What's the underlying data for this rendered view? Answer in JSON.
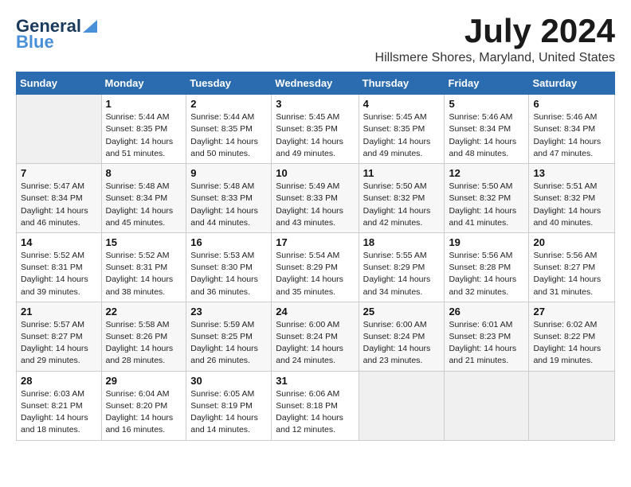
{
  "header": {
    "logo_line1": "General",
    "logo_line2": "Blue",
    "month_title": "July 2024",
    "location": "Hillsmere Shores, Maryland, United States"
  },
  "weekdays": [
    "Sunday",
    "Monday",
    "Tuesday",
    "Wednesday",
    "Thursday",
    "Friday",
    "Saturday"
  ],
  "weeks": [
    [
      {
        "day": "",
        "info": ""
      },
      {
        "day": "1",
        "info": "Sunrise: 5:44 AM\nSunset: 8:35 PM\nDaylight: 14 hours\nand 51 minutes."
      },
      {
        "day": "2",
        "info": "Sunrise: 5:44 AM\nSunset: 8:35 PM\nDaylight: 14 hours\nand 50 minutes."
      },
      {
        "day": "3",
        "info": "Sunrise: 5:45 AM\nSunset: 8:35 PM\nDaylight: 14 hours\nand 49 minutes."
      },
      {
        "day": "4",
        "info": "Sunrise: 5:45 AM\nSunset: 8:35 PM\nDaylight: 14 hours\nand 49 minutes."
      },
      {
        "day": "5",
        "info": "Sunrise: 5:46 AM\nSunset: 8:34 PM\nDaylight: 14 hours\nand 48 minutes."
      },
      {
        "day": "6",
        "info": "Sunrise: 5:46 AM\nSunset: 8:34 PM\nDaylight: 14 hours\nand 47 minutes."
      }
    ],
    [
      {
        "day": "7",
        "info": "Sunrise: 5:47 AM\nSunset: 8:34 PM\nDaylight: 14 hours\nand 46 minutes."
      },
      {
        "day": "8",
        "info": "Sunrise: 5:48 AM\nSunset: 8:34 PM\nDaylight: 14 hours\nand 45 minutes."
      },
      {
        "day": "9",
        "info": "Sunrise: 5:48 AM\nSunset: 8:33 PM\nDaylight: 14 hours\nand 44 minutes."
      },
      {
        "day": "10",
        "info": "Sunrise: 5:49 AM\nSunset: 8:33 PM\nDaylight: 14 hours\nand 43 minutes."
      },
      {
        "day": "11",
        "info": "Sunrise: 5:50 AM\nSunset: 8:32 PM\nDaylight: 14 hours\nand 42 minutes."
      },
      {
        "day": "12",
        "info": "Sunrise: 5:50 AM\nSunset: 8:32 PM\nDaylight: 14 hours\nand 41 minutes."
      },
      {
        "day": "13",
        "info": "Sunrise: 5:51 AM\nSunset: 8:32 PM\nDaylight: 14 hours\nand 40 minutes."
      }
    ],
    [
      {
        "day": "14",
        "info": "Sunrise: 5:52 AM\nSunset: 8:31 PM\nDaylight: 14 hours\nand 39 minutes."
      },
      {
        "day": "15",
        "info": "Sunrise: 5:52 AM\nSunset: 8:31 PM\nDaylight: 14 hours\nand 38 minutes."
      },
      {
        "day": "16",
        "info": "Sunrise: 5:53 AM\nSunset: 8:30 PM\nDaylight: 14 hours\nand 36 minutes."
      },
      {
        "day": "17",
        "info": "Sunrise: 5:54 AM\nSunset: 8:29 PM\nDaylight: 14 hours\nand 35 minutes."
      },
      {
        "day": "18",
        "info": "Sunrise: 5:55 AM\nSunset: 8:29 PM\nDaylight: 14 hours\nand 34 minutes."
      },
      {
        "day": "19",
        "info": "Sunrise: 5:56 AM\nSunset: 8:28 PM\nDaylight: 14 hours\nand 32 minutes."
      },
      {
        "day": "20",
        "info": "Sunrise: 5:56 AM\nSunset: 8:27 PM\nDaylight: 14 hours\nand 31 minutes."
      }
    ],
    [
      {
        "day": "21",
        "info": "Sunrise: 5:57 AM\nSunset: 8:27 PM\nDaylight: 14 hours\nand 29 minutes."
      },
      {
        "day": "22",
        "info": "Sunrise: 5:58 AM\nSunset: 8:26 PM\nDaylight: 14 hours\nand 28 minutes."
      },
      {
        "day": "23",
        "info": "Sunrise: 5:59 AM\nSunset: 8:25 PM\nDaylight: 14 hours\nand 26 minutes."
      },
      {
        "day": "24",
        "info": "Sunrise: 6:00 AM\nSunset: 8:24 PM\nDaylight: 14 hours\nand 24 minutes."
      },
      {
        "day": "25",
        "info": "Sunrise: 6:00 AM\nSunset: 8:24 PM\nDaylight: 14 hours\nand 23 minutes."
      },
      {
        "day": "26",
        "info": "Sunrise: 6:01 AM\nSunset: 8:23 PM\nDaylight: 14 hours\nand 21 minutes."
      },
      {
        "day": "27",
        "info": "Sunrise: 6:02 AM\nSunset: 8:22 PM\nDaylight: 14 hours\nand 19 minutes."
      }
    ],
    [
      {
        "day": "28",
        "info": "Sunrise: 6:03 AM\nSunset: 8:21 PM\nDaylight: 14 hours\nand 18 minutes."
      },
      {
        "day": "29",
        "info": "Sunrise: 6:04 AM\nSunset: 8:20 PM\nDaylight: 14 hours\nand 16 minutes."
      },
      {
        "day": "30",
        "info": "Sunrise: 6:05 AM\nSunset: 8:19 PM\nDaylight: 14 hours\nand 14 minutes."
      },
      {
        "day": "31",
        "info": "Sunrise: 6:06 AM\nSunset: 8:18 PM\nDaylight: 14 hours\nand 12 minutes."
      },
      {
        "day": "",
        "info": ""
      },
      {
        "day": "",
        "info": ""
      },
      {
        "day": "",
        "info": ""
      }
    ]
  ]
}
